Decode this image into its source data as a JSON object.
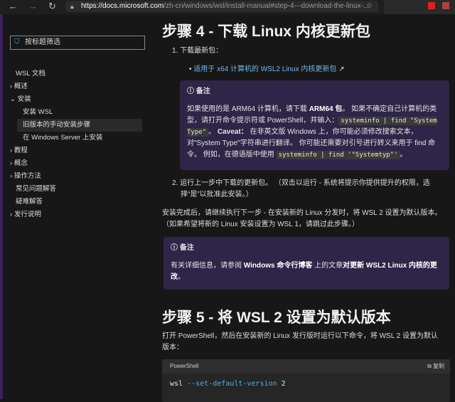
{
  "browser": {
    "url_host": "https://docs.microsoft.com",
    "url_path": "/zh-cn/windows/wsl/install-manual#step-4---download-the-linux-..."
  },
  "sidebar": {
    "filter_placeholder": "按标题筛选",
    "items": [
      {
        "label": "WSL 文档",
        "level": 0
      },
      {
        "label": "概述",
        "level": 0,
        "chevron": ">"
      },
      {
        "label": "安装",
        "level": 0,
        "chevron": "v"
      },
      {
        "label": "安装 WSL",
        "level": 1
      },
      {
        "label": "旧版本的手动安装步骤",
        "level": 1,
        "selected": true
      },
      {
        "label": "在 Windows Server 上安装",
        "level": 1
      },
      {
        "label": "教程",
        "level": 0,
        "chevron": ">"
      },
      {
        "label": "概念",
        "level": 0,
        "chevron": ">"
      },
      {
        "label": "操作方法",
        "level": 0,
        "chevron": ">"
      },
      {
        "label": "常见问题解答",
        "level": 0
      },
      {
        "label": "疑难解答",
        "level": 0
      },
      {
        "label": "发行说明",
        "level": 0,
        "chevron": ">"
      }
    ]
  },
  "main": {
    "h4": "步骤 4 - 下载 Linux 内核更新包",
    "step1": "1. 下载最新包：",
    "link1": "适用于 x64 计算机的 WSL2 Linux 内核更新包",
    "note1": {
      "title": "备注",
      "t1": "如果使用的是 ARM64 计算机，请下载 ",
      "link": "ARM64 包",
      "t2": "。 如果不确定自己计算机的类型，请打开命令提示符或 PowerShell，并输入：",
      "code1": "systeminfo | find \"System Type\"",
      "t3": "。 ",
      "caveat": "Caveat：",
      "t4": " 在非英文版 Windows 上，你可能必须修改搜索文本，对\"System Type\"字符串进行翻译。 你可能还需要对引号进行转义来用于 find 命令。 例如，在德语版中使用 ",
      "code2": "systeminfo | find '\"Systemtyp\"'",
      "t5": "。"
    },
    "step2": "2. 运行上一步中下载的更新包。 （双击以运行 - 系统将提示你提供提升的权限，选择“是”以批准此安装。）",
    "after": "安装完成后，请继续执行下一步 - 在安装新的 Linux 分发时，将 WSL 2 设置为默认版本。（如果希望将新的 Linux 安装设置为 WSL 1，请跳过此步骤。）",
    "note2": {
      "title": "备注",
      "t1": "有关详细信息，请参阅 ",
      "link1": "Windows 命令行博客",
      "t2": " 上的文章",
      "link2": "对更新 WSL2 Linux 内核的更改",
      "t3": "。"
    },
    "h5": "步骤 5 - 将 WSL 2 设置为默认版本",
    "p5": "打开 PowerShell，然后在安装新的 Linux 发行版时运行以下命令，将 WSL 2 设置为默认版本：",
    "code": {
      "lang": "PowerShell",
      "copy": "复制",
      "cmd": "wsl",
      "flag": "--set-default-version",
      "arg": "2"
    }
  }
}
